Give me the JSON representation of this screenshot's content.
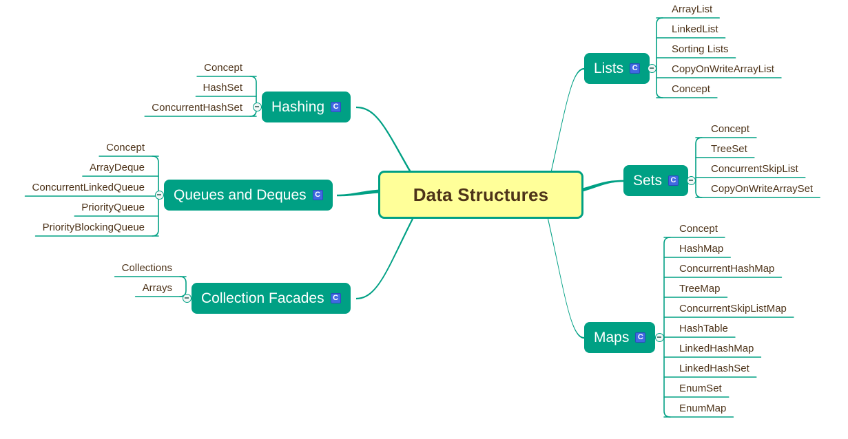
{
  "map": {
    "root": {
      "label": "Data Structures",
      "fill": "#ffff99",
      "border": "#00a084",
      "text": "#4d3319"
    },
    "theme": {
      "branch_fill": "#00a084",
      "branch_text": "#ffffff",
      "leaf_text": "#4d3319",
      "connector": "#00a084",
      "badge_fill": "#4169e1",
      "badge_text": "#ffffff",
      "background": "#ffffff"
    },
    "badge": {
      "label": "C",
      "name": "attachment-badge"
    },
    "toggle": {
      "state": "expanded",
      "glyph": "minus"
    },
    "branches": [
      {
        "id": "lists",
        "label": "Lists",
        "side": "right",
        "badge": "C",
        "leaves": [
          "ArrayList",
          "LinkedList",
          "Sorting Lists",
          "CopyOnWriteArrayList",
          "Concept"
        ]
      },
      {
        "id": "sets",
        "label": "Sets",
        "side": "right",
        "badge": "C",
        "leaves": [
          "Concept",
          "TreeSet",
          "ConcurrentSkipList",
          "CopyOnWriteArraySet"
        ]
      },
      {
        "id": "maps",
        "label": "Maps",
        "side": "right",
        "badge": "C",
        "leaves": [
          "Concept",
          "HashMap",
          "ConcurrentHashMap",
          "TreeMap",
          "ConcurrentSkipListMap",
          "HashTable",
          "LinkedHashMap",
          "LinkedHashSet",
          "EnumSet",
          "EnumMap"
        ]
      },
      {
        "id": "hashing",
        "label": "Hashing",
        "side": "left",
        "badge": "C",
        "leaves": [
          "Concept",
          "HashSet",
          "ConcurrentHashSet"
        ]
      },
      {
        "id": "queues-and-deques",
        "label": "Queues and Deques",
        "side": "left",
        "badge": "C",
        "leaves": [
          "Concept",
          "ArrayDeque",
          "ConcurrentLinkedQueue",
          "PriorityQueue",
          "PriorityBlockingQueue"
        ]
      },
      {
        "id": "collection-facades",
        "label": "Collection Facades",
        "side": "left",
        "badge": "C",
        "leaves": [
          "Collections",
          "Arrays"
        ]
      }
    ]
  }
}
